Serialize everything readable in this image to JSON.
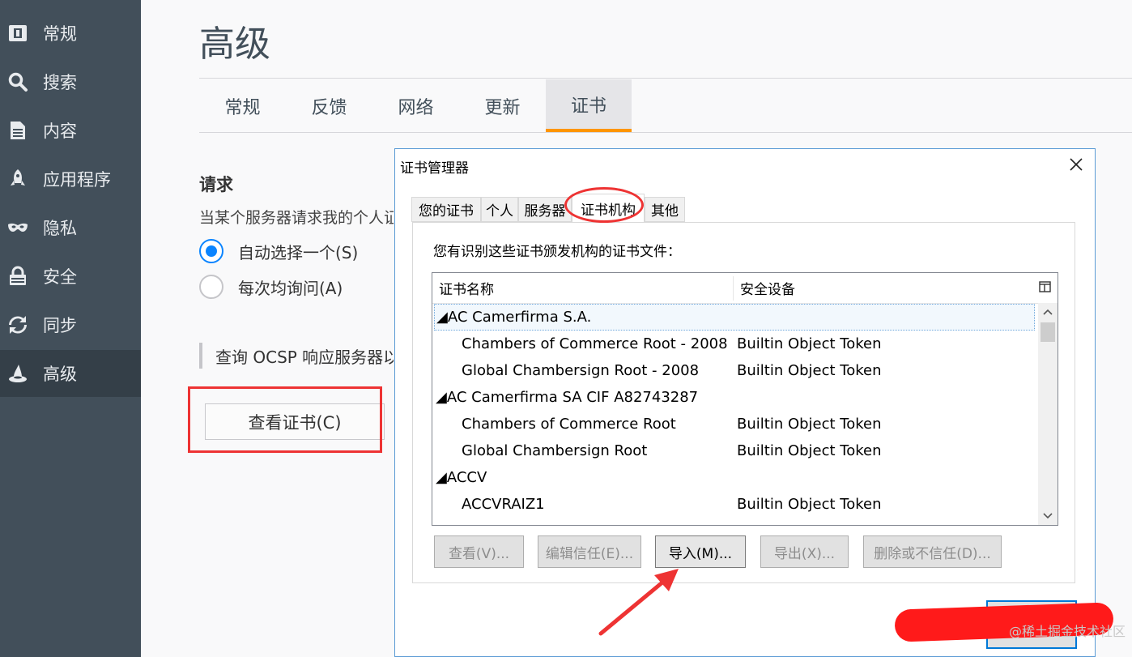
{
  "sidebar": {
    "items": [
      {
        "label": "常规",
        "icon": "general-icon"
      },
      {
        "label": "搜索",
        "icon": "search-icon"
      },
      {
        "label": "内容",
        "icon": "document-icon"
      },
      {
        "label": "应用程序",
        "icon": "rocket-icon"
      },
      {
        "label": "隐私",
        "icon": "mask-icon"
      },
      {
        "label": "安全",
        "icon": "lock-icon"
      },
      {
        "label": "同步",
        "icon": "sync-icon"
      },
      {
        "label": "高级",
        "icon": "wizard-hat-icon",
        "active": true
      }
    ]
  },
  "page": {
    "title": "高级",
    "tabs": [
      {
        "label": "常规"
      },
      {
        "label": "反馈"
      },
      {
        "label": "网络"
      },
      {
        "label": "更新"
      },
      {
        "label": "证书",
        "active": true
      }
    ]
  },
  "requests": {
    "title": "请求",
    "description": "当某个服务器请求我的个人证书时",
    "auto_select_label": "自动选择一个(S)",
    "ask_every_time_label": "每次均询问(A)",
    "ocsp_label": "查询 OCSP 响应服务器以确认证书的当前有效性"
  },
  "view_certificates_button": "查看证书(C)",
  "dialog": {
    "title": "证书管理器",
    "tabs": [
      {
        "label": "您的证书"
      },
      {
        "label": "个人"
      },
      {
        "label": "服务器"
      },
      {
        "label": "证书机构",
        "active": true
      },
      {
        "label": "其他"
      }
    ],
    "description": "您有识别这些证书颁发机构的证书文件：",
    "columns": {
      "name": "证书名称",
      "device": "安全设备"
    },
    "rows": [
      {
        "name": "◢AC Camerfirma S.A.",
        "device": "",
        "group": true,
        "selected": true
      },
      {
        "name": "Chambers of Commerce Root - 2008",
        "device": "Builtin Object Token",
        "group": false
      },
      {
        "name": "Global Chambersign Root - 2008",
        "device": "Builtin Object Token",
        "group": false
      },
      {
        "name": "◢AC Camerfirma SA CIF A82743287",
        "device": "",
        "group": true
      },
      {
        "name": "Chambers of Commerce Root",
        "device": "Builtin Object Token",
        "group": false
      },
      {
        "name": "Global Chambersign Root",
        "device": "Builtin Object Token",
        "group": false
      },
      {
        "name": "◢ACCV",
        "device": "",
        "group": true
      },
      {
        "name": "ACCVRAIZ1",
        "device": "Builtin Object Token",
        "group": false
      }
    ],
    "buttons": {
      "view": "查看(V)...",
      "edit_trust": "编辑信任(E)...",
      "import": "导入(M)...",
      "export": "导出(X)...",
      "delete": "删除或不信任(D)..."
    }
  },
  "watermark": "@稀土掘金技术社区",
  "colors": {
    "sidebar_bg": "#424f5a",
    "accent": "#0a84ff",
    "tab_active_underline": "#ff9500",
    "annotation_red": "#ee3333"
  }
}
